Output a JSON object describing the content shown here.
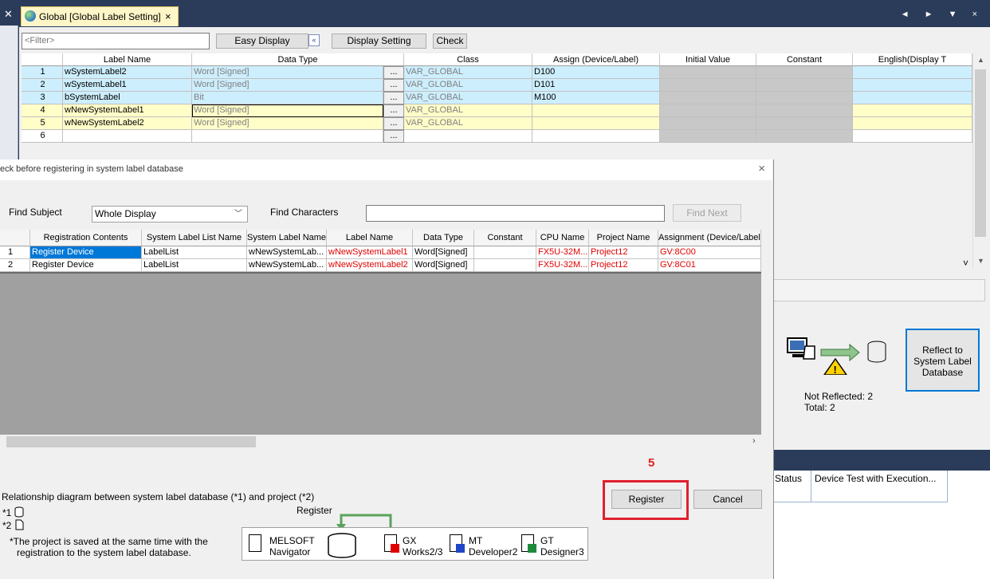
{
  "tab": {
    "title": "Global [Global Label Setting]",
    "close": "×"
  },
  "window_controls": "◄ ► ▼ ×",
  "toolbar": {
    "filter_placeholder": "<Filter>",
    "easy_display": "Easy Display",
    "collapse": "«",
    "display_setting": "Display Setting",
    "check": "Check"
  },
  "label_grid": {
    "columns": [
      "Label Name",
      "Data Type",
      "Class",
      "Assign (Device/Label)",
      "Initial Value",
      "Constant",
      "English(Display T"
    ],
    "rows": [
      {
        "num": "1",
        "name": "wSystemLabel2",
        "type": "Word [Signed]",
        "dots": "...",
        "class": "VAR_GLOBAL",
        "assign": "D100"
      },
      {
        "num": "2",
        "name": "wSystemLabel1",
        "type": "Word [Signed]",
        "dots": "...",
        "class": "VAR_GLOBAL",
        "assign": "D101"
      },
      {
        "num": "3",
        "name": "bSystemLabel",
        "type": "Bit",
        "dots": "...",
        "class": "VAR_GLOBAL",
        "assign": "M100"
      },
      {
        "num": "4",
        "name": "wNewSystemLabel1",
        "type": "Word [Signed]",
        "dots": "...",
        "class": "VAR_GLOBAL",
        "assign": ""
      },
      {
        "num": "5",
        "name": "wNewSystemLabel2",
        "type": "Word [Signed]",
        "dots": "...",
        "class": "VAR_GLOBAL",
        "assign": ""
      },
      {
        "num": "6",
        "name": "",
        "type": "",
        "dots": "...",
        "class": "",
        "assign": ""
      }
    ]
  },
  "right_panel": {
    "chevron": "˅",
    "reflect_button": "Reflect to System Label Database",
    "not_reflected": "Not Reflected: 2",
    "total": "Total: 2"
  },
  "output_pane": {
    "status": "Status",
    "device_test": "Device Test with Execution..."
  },
  "dialog": {
    "title": "eck before registering in system label database",
    "close": "×",
    "find_subject_label": "Find Subject",
    "find_subject_value": "Whole Display",
    "find_chars_label": "Find Characters",
    "find_next": "Find Next",
    "columns": [
      "",
      "Registration Contents",
      "System Label List Name",
      "System Label Name",
      "Label Name",
      "Data Type",
      "Constant",
      "CPU Name",
      "Project Name",
      "Assignment (Device/Label)"
    ],
    "rows": [
      {
        "num": "1",
        "contents": "Register Device",
        "list": "LabelList",
        "sysname": "wNewSystemLab...",
        "label": "wNewSystemLabel1",
        "type": "Word[Signed]",
        "constant": "",
        "cpu": "FX5U-32M...",
        "project": "Project12",
        "assign": "GV:8C00"
      },
      {
        "num": "2",
        "contents": "Register Device",
        "list": "LabelList",
        "sysname": "wNewSystemLab...",
        "label": "wNewSystemLabel2",
        "type": "Word[Signed]",
        "constant": "",
        "cpu": "FX5U-32M...",
        "project": "Project12",
        "assign": "GV:8C01"
      }
    ],
    "step_number": "5",
    "register": "Register",
    "cancel": "Cancel",
    "relationship": "Relationship diagram between system label database (*1) and project (*2)",
    "note1": "*1",
    "note2": "*2",
    "register_caption": "Register",
    "save_note_1": "*The project is saved at the same time with the",
    "save_note_2": "registration to the system label database.",
    "products": [
      {
        "line1": "MELSOFT",
        "line2": "Navigator"
      },
      {
        "line1": "GX",
        "line2": "Works2/3"
      },
      {
        "line1": "MT",
        "line2": "Developer2"
      },
      {
        "line1": "GT",
        "line2": "Designer3"
      }
    ]
  },
  "colors": {
    "highlight_blue": "#cdeefd",
    "highlight_yellow": "#fffdc8",
    "selection": "#0078d7",
    "warning_red": "#e02020"
  }
}
